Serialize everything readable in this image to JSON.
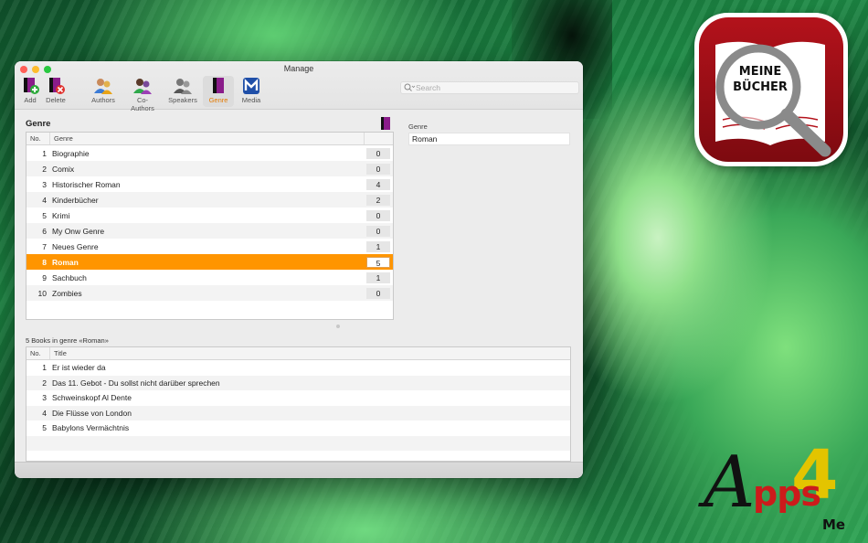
{
  "window": {
    "title": "Manage"
  },
  "toolbar": {
    "items": [
      {
        "label": "Add",
        "icon": "add-book-icon"
      },
      {
        "label": "Delete",
        "icon": "delete-book-icon"
      },
      {
        "label": "Authors",
        "icon": "authors-icon"
      },
      {
        "label": "Co-Authors",
        "icon": "co-authors-icon"
      },
      {
        "label": "Speakers",
        "icon": "speakers-icon"
      },
      {
        "label": "Genre",
        "icon": "genre-icon",
        "active": true
      },
      {
        "label": "Media",
        "icon": "media-icon"
      }
    ],
    "search_placeholder": "Search"
  },
  "genre_panel": {
    "title": "Genre",
    "columns": {
      "no": "No.",
      "name": "Genre"
    },
    "rows": [
      {
        "no": "1",
        "name": "Biographie",
        "count": "0"
      },
      {
        "no": "2",
        "name": "Comix",
        "count": "0"
      },
      {
        "no": "3",
        "name": "Historischer Roman",
        "count": "4"
      },
      {
        "no": "4",
        "name": "Kinderbücher",
        "count": "2"
      },
      {
        "no": "5",
        "name": "Krimi",
        "count": "0"
      },
      {
        "no": "6",
        "name": "My Onw Genre",
        "count": "0"
      },
      {
        "no": "7",
        "name": "Neues Genre",
        "count": "1"
      },
      {
        "no": "8",
        "name": "Roman",
        "count": "5",
        "selected": true
      },
      {
        "no": "9",
        "name": "Sachbuch",
        "count": "1"
      },
      {
        "no": "10",
        "name": "Zombies",
        "count": "0"
      }
    ]
  },
  "detail": {
    "label": "Genre",
    "value": "Roman"
  },
  "books_panel": {
    "caption": "5 Books in genre «Roman»",
    "columns": {
      "no": "No.",
      "title": "Title"
    },
    "rows": [
      {
        "no": "1",
        "title": "Er ist wieder da"
      },
      {
        "no": "2",
        "title": "Das 11. Gebot - Du sollst nicht darüber sprechen"
      },
      {
        "no": "3",
        "title": "Schweinskopf Al Dente"
      },
      {
        "no": "4",
        "title": "Die Flüsse von London"
      },
      {
        "no": "5",
        "title": "Babylons Vermächtnis"
      }
    ]
  },
  "promo": {
    "app_name_line1": "MEINE",
    "app_name_line2": "BÜCHER",
    "brand_a": "A",
    "brand_4": "4",
    "brand_pps": "pps",
    "brand_me": "Me"
  },
  "colors": {
    "accent": "#ff9500",
    "active_label": "#e57a00",
    "icon_red": "#b3121b"
  }
}
